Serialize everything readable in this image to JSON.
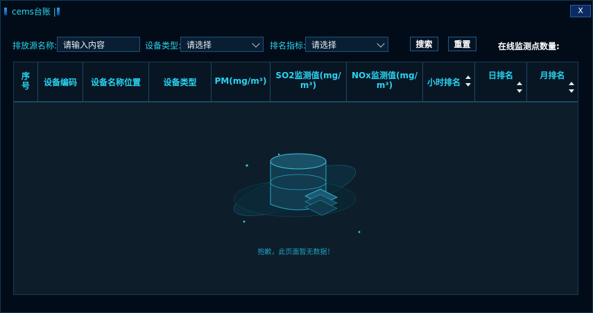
{
  "window": {
    "title": "cems台账 |",
    "close_label": "X"
  },
  "filters": {
    "source_name_label": "排放源名称:",
    "source_name_placeholder": "请输入内容",
    "device_type_label": "设备类型:",
    "device_type_value": "请选择",
    "rank_index_label": "排名指标:",
    "rank_index_value": "请选择",
    "search_label": "搜索",
    "reset_label": "重置",
    "online_points_label": "在线监测点数量:"
  },
  "table": {
    "columns": [
      {
        "key": "index",
        "label": "序号"
      },
      {
        "key": "device_code",
        "label": "设备编码"
      },
      {
        "key": "device_location",
        "label": "设备名称位置"
      },
      {
        "key": "device_type",
        "label": "设备类型"
      },
      {
        "key": "pm",
        "label": "PM(mg/m³)"
      },
      {
        "key": "so2",
        "label": "SO2监测值(mg/m³)"
      },
      {
        "key": "nox",
        "label": "NOx监测值(mg/m³)"
      },
      {
        "key": "hour_rank",
        "label": "小时排名"
      },
      {
        "key": "day_rank",
        "label": "日排名"
      },
      {
        "key": "month_rank",
        "label": "月排名"
      }
    ],
    "rows": [],
    "empty_message": "抱歉，此页面暂无数据！"
  },
  "colors": {
    "accent_cyan": "#2ad3ef",
    "background": "#020c18",
    "table_body": "#0d1e2a"
  }
}
